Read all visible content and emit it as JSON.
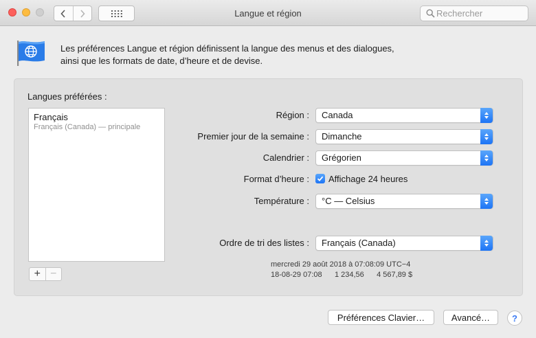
{
  "window": {
    "title": "Langue et région",
    "search_placeholder": "Rechercher"
  },
  "header": {
    "description_line1": "Les préférences Langue et région définissent la langue des menus et des dialogues,",
    "description_line2": "ainsi que les formats de date, d’heure et de devise."
  },
  "languages": {
    "label": "Langues préférées :",
    "items": [
      {
        "name": "Français",
        "detail": "Français (Canada) — principale"
      }
    ],
    "add_label": "+",
    "remove_label": "−"
  },
  "settings": {
    "region": {
      "label": "Région :",
      "value": "Canada"
    },
    "first_day": {
      "label": "Premier jour de la semaine :",
      "value": "Dimanche"
    },
    "calendar": {
      "label": "Calendrier :",
      "value": "Grégorien"
    },
    "time_format": {
      "label": "Format d’heure :",
      "checkbox_label": "Affichage 24 heures",
      "checked": true
    },
    "temperature": {
      "label": "Température :",
      "value": "°C — Celsius"
    },
    "sort_order": {
      "label": "Ordre de tri des listes :",
      "value": "Français (Canada)"
    }
  },
  "sample": {
    "line1": "mercredi 29 août 2018 à 07:08:09 UTC−4",
    "line2": "18-08-29 07:08      1 234,56      4 567,89 $"
  },
  "buttons": {
    "keyboard": "Préférences Clavier…",
    "advanced": "Avancé…",
    "help": "?"
  },
  "colors": {
    "accent": "#1d74f5",
    "close": "#fc605c",
    "minimize": "#fdbc40"
  }
}
